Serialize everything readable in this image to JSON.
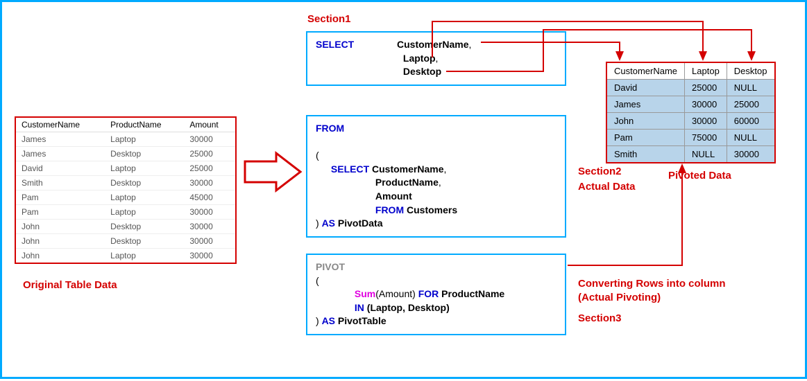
{
  "labels": {
    "section1": "Section1",
    "section2_line1": "Section2",
    "section2_line2": "Actual Data",
    "section3_line1": "Converting Rows into column",
    "section3_line2": "(Actual Pivoting)",
    "section3_line3": "Section3",
    "original": "Original Table Data",
    "pivoted": "Pivoted Data"
  },
  "code": {
    "select_kw": "SELECT",
    "select_col1": "CustomerName",
    "select_col2": "Laptop",
    "select_col3": "Desktop",
    "from_kw": "FROM",
    "paren_open": "(",
    "inner_select": "SELECT",
    "inner_col1": "CustomerName",
    "inner_col2": "ProductName",
    "inner_col3": "Amount",
    "inner_from": "FROM",
    "inner_from_tbl": "Customers",
    "as_kw": "AS",
    "pivotdata": "PivotData",
    "pivot_kw": "PIVOT",
    "sum_kw": "Sum",
    "sum_arg": "(Amount)",
    "for_kw": "FOR",
    "for_col": "ProductName",
    "in_kw": "IN",
    "in_vals": "(Laptop, Desktop)",
    "pivottable": "PivotTable"
  },
  "original_table": {
    "headers": [
      "CustomerName",
      "ProductName",
      "Amount"
    ],
    "rows": [
      [
        "James",
        "Laptop",
        "30000"
      ],
      [
        "James",
        "Desktop",
        "25000"
      ],
      [
        "David",
        "Laptop",
        "25000"
      ],
      [
        "Smith",
        "Desktop",
        "30000"
      ],
      [
        "Pam",
        "Laptop",
        "45000"
      ],
      [
        "Pam",
        "Laptop",
        "30000"
      ],
      [
        "John",
        "Desktop",
        "30000"
      ],
      [
        "John",
        "Desktop",
        "30000"
      ],
      [
        "John",
        "Laptop",
        "30000"
      ]
    ]
  },
  "pivot_table": {
    "headers": [
      "CustomerName",
      "Laptop",
      "Desktop"
    ],
    "rows": [
      [
        "David",
        "25000",
        "NULL"
      ],
      [
        "James",
        "30000",
        "25000"
      ],
      [
        "John",
        "30000",
        "60000"
      ],
      [
        "Pam",
        "75000",
        "NULL"
      ],
      [
        "Smith",
        "NULL",
        "30000"
      ]
    ]
  }
}
